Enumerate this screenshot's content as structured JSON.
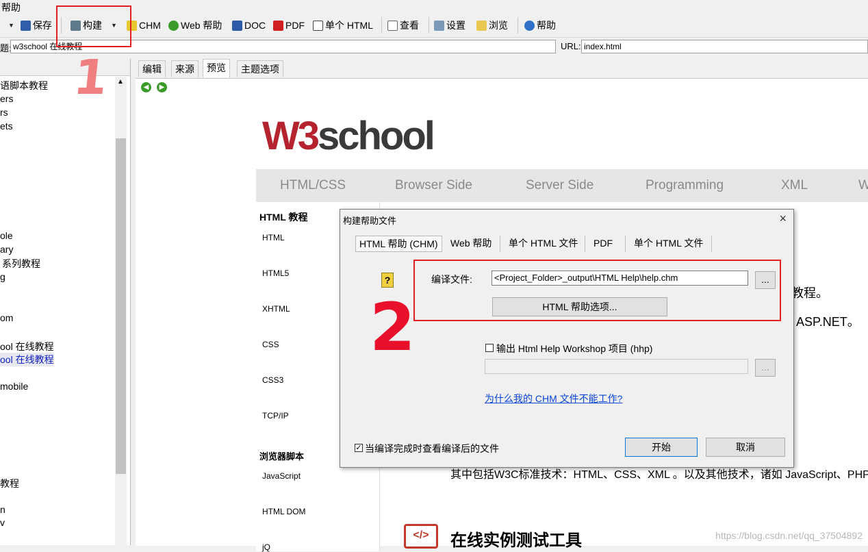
{
  "menu": {
    "help": "帮助"
  },
  "toolbar": {
    "save": "保存",
    "build": "构建",
    "chm": "CHM",
    "web_help": "Web 帮助",
    "doc": "DOC",
    "pdf": "PDF",
    "single_html": "单个 HTML",
    "view": "查看",
    "settings": "设置",
    "browse": "浏览",
    "help": "帮助"
  },
  "titlebar": {
    "title_label": "题:",
    "title_value": "w3school 在线教程",
    "url_label": "URL:",
    "url_value": "index.html"
  },
  "tree": {
    "items": [
      "语脚本教程",
      "ers",
      "rs",
      "ets",
      "ole",
      "ary",
      "系列教程",
      "g",
      "om",
      "ool 在线教程",
      "ool 在线教程",
      "mobile",
      "教程",
      "n",
      "v"
    ]
  },
  "editor_tabs": [
    "编辑",
    "来源",
    "预览",
    "主题选项"
  ],
  "webpage": {
    "logo_w3": "W3",
    "logo_school": "school",
    "nav": [
      "HTML/CSS",
      "Browser Side",
      "Server Side",
      "Programming",
      "XML",
      "W"
    ],
    "side_html_header": "HTML 教程",
    "side_html_items": [
      "HTML",
      "HTML5",
      "XHTML",
      "CSS",
      "CSS3",
      "TCP/IP"
    ],
    "side_browser_header": "浏览器脚本",
    "side_browser_items": [
      "JavaScript",
      "HTML DOM",
      "jQ"
    ],
    "text_fragment_1": "教程。",
    "text_fragment_2": "ASP.NET。",
    "text_line": "其中包括W3C标准技术：HTML、CSS、XML 。以及其他技术，诸如 JavaScript、PHP",
    "section_title": "在线实例测试工具",
    "code_icon": "</>"
  },
  "dialog": {
    "title": "构建帮助文件",
    "close": "×",
    "tabs": [
      "HTML 帮助 (CHM)",
      "Web 帮助",
      "单个 HTML 文件",
      "PDF",
      "单个 HTML 文件"
    ],
    "compile_label": "编译文件:",
    "compile_value": "<Project_Folder>_output\\HTML Help\\help.chm",
    "browse_btn": "...",
    "options_btn": "HTML 帮助选项...",
    "hhp_checkbox_label": "输出 Html Help Workshop 项目 (hhp)",
    "hhp_browse_btn": "...",
    "link": "为什么我的 CHM 文件不能工作?",
    "view_after_label": "当编译完成时查看编译后的文件",
    "view_after_checked": true,
    "start_btn": "开始",
    "cancel_btn": "取消"
  },
  "annotations": {
    "mark1": "1",
    "mark2": "2"
  },
  "watermark": "https://blog.csdn.net/qq_37504892",
  "colors": {
    "annotation_red": "#e02020",
    "link_blue": "#0645d8",
    "w3_red": "#b5232e"
  }
}
